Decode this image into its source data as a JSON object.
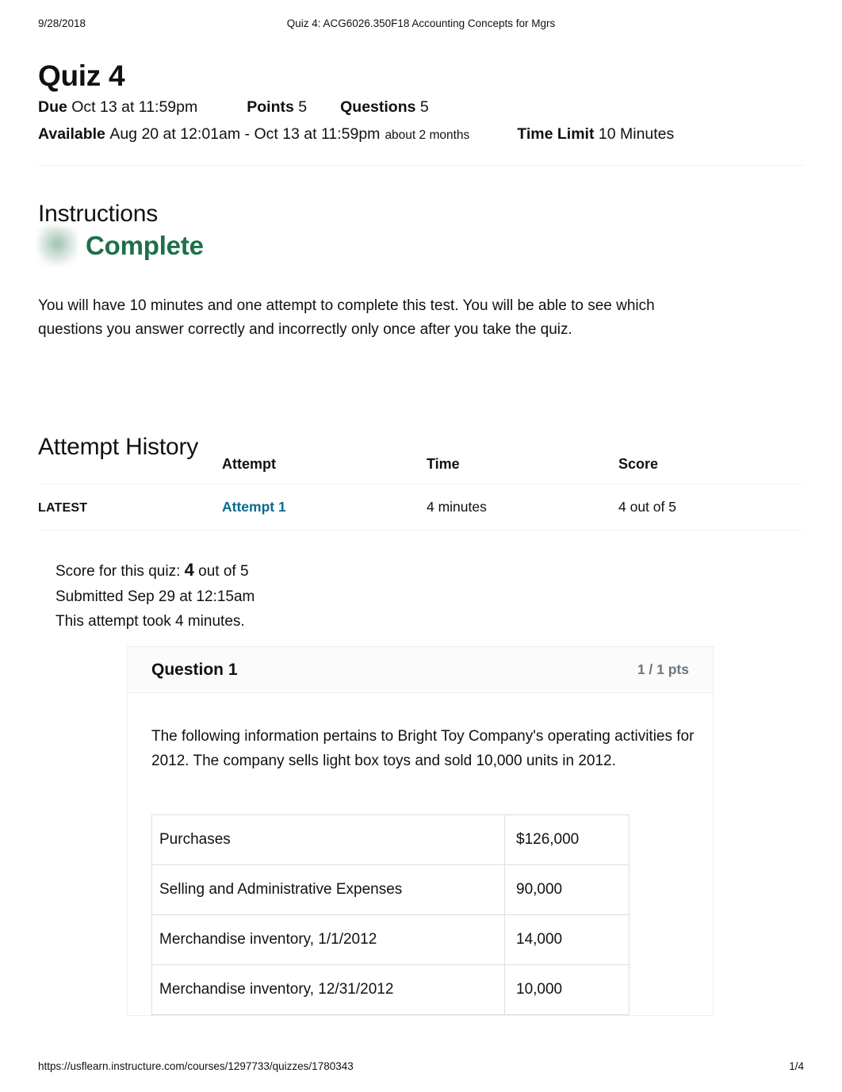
{
  "print_header": {
    "date": "9/28/2018",
    "title": "Quiz 4: ACG6026.350F18 Accounting Concepts for Mgrs"
  },
  "quiz": {
    "title": "Quiz 4",
    "meta": {
      "due_label": "Due",
      "due_value": "Oct 13 at 11:59pm",
      "points_label": "Points",
      "points_value": "5",
      "questions_label": "Questions",
      "questions_value": "5",
      "available_label": "Available",
      "available_value": "Aug 20 at 12:01am - Oct 13 at 11:59pm",
      "available_duration": "about 2 months",
      "time_limit_label": "Time Limit",
      "time_limit_value": "10 Minutes"
    }
  },
  "instructions": {
    "heading": "Instructions",
    "status_badge_icon": "complete-check-image",
    "status": "Complete",
    "status_color": "#1d7049",
    "body": "You will have 10 minutes and one attempt to complete this test. You will be able to see which questions you answer correctly and incorrectly only once after you take the quiz."
  },
  "attempt_history": {
    "heading": "Attempt History",
    "columns": [
      "",
      "Attempt",
      "Time",
      "Score"
    ],
    "rows": [
      {
        "badge": "LATEST",
        "attempt": "Attempt 1",
        "attempt_link_color": "#0b6a8f",
        "time": "4 minutes",
        "score": "4 out of 5"
      }
    ]
  },
  "score_summary": {
    "score_prefix": "Score for this quiz:",
    "score_value": "4",
    "score_suffix": "out of 5",
    "submitted": "Submitted Sep 29 at 12:15am",
    "duration": "This attempt took 4 minutes."
  },
  "question": {
    "name": "Question 1",
    "points": "1 / 1 pts",
    "text": "The following information pertains to Bright Toy Company's operating activities for 2012. The company sells light box toys and sold 10,000 units in 2012.",
    "data_table": {
      "rows": [
        {
          "label": "Purchases",
          "value": "$126,000"
        },
        {
          "label": "Selling and Administrative Expenses",
          "value": "90,000"
        },
        {
          "label": "Merchandise inventory, 1/1/2012",
          "value": "14,000"
        },
        {
          "label": "Merchandise inventory, 12/31/2012",
          "value": "10,000"
        }
      ]
    }
  },
  "print_footer": {
    "url": "https://usflearn.instructure.com/courses/1297733/quizzes/1780343",
    "page": "1/4"
  }
}
